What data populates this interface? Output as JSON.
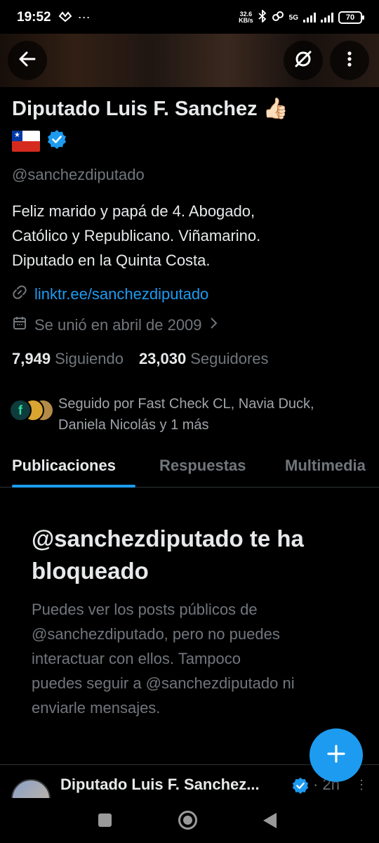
{
  "status_bar": {
    "time": "19:52",
    "extra_icons": "⋯",
    "net_speed_value": "32.6",
    "net_speed_unit": "KB/s",
    "network": "5G",
    "battery": "70"
  },
  "profile": {
    "name": "Diputado Luis F. Sanchez",
    "name_emoji": "👍🏻",
    "handle": "@sanchezdiputado",
    "bio_lines": [
      "Feliz marido y papá de 4. Abogado,",
      "Católico y Republicano. Viñamarino.",
      "Diputado en la Quinta Costa."
    ],
    "link": "linktr.ee/sanchezdiputado",
    "joined": "Se unió en abril de 2009",
    "following_count": "7,949",
    "following_label": "Siguiendo",
    "followers_count": "23,030",
    "followers_label": "Seguidores",
    "followed_by_lines": [
      "Seguido por Fast Check CL, Navia Duck,",
      "Daniela Nicolás y 1 más"
    ]
  },
  "tabs": [
    {
      "label": "Publicaciones",
      "active": true
    },
    {
      "label": "Respuestas",
      "active": false
    },
    {
      "label": "Multimedia",
      "active": false
    }
  ],
  "blocked": {
    "title_lines": [
      "@sanchezdiputado te ha",
      "bloqueado"
    ],
    "desc_lines": [
      "Puedes ver los posts públicos de",
      "@sanchezdiputado, pero no puedes",
      "interactuar con ellos. Tampoco",
      "puedes seguir a @sanchezdiputado ni",
      "enviarle mensajes."
    ]
  },
  "post_preview": {
    "name": "Diputado Luis F. Sanchez...",
    "separator": "·",
    "time": "2h",
    "more": "⋮"
  },
  "colors": {
    "accent": "#1d9bf0",
    "background": "#000000",
    "text_primary": "#e7e9ea",
    "text_secondary": "#71767b"
  },
  "icons": {
    "back": "arrow-left-icon",
    "grok": "grok-icon",
    "more": "more-vertical-icon",
    "verified": "verified-badge-icon",
    "link": "link-icon",
    "calendar": "calendar-icon",
    "chevron": "chevron-right-icon",
    "compose": "plus-icon"
  }
}
